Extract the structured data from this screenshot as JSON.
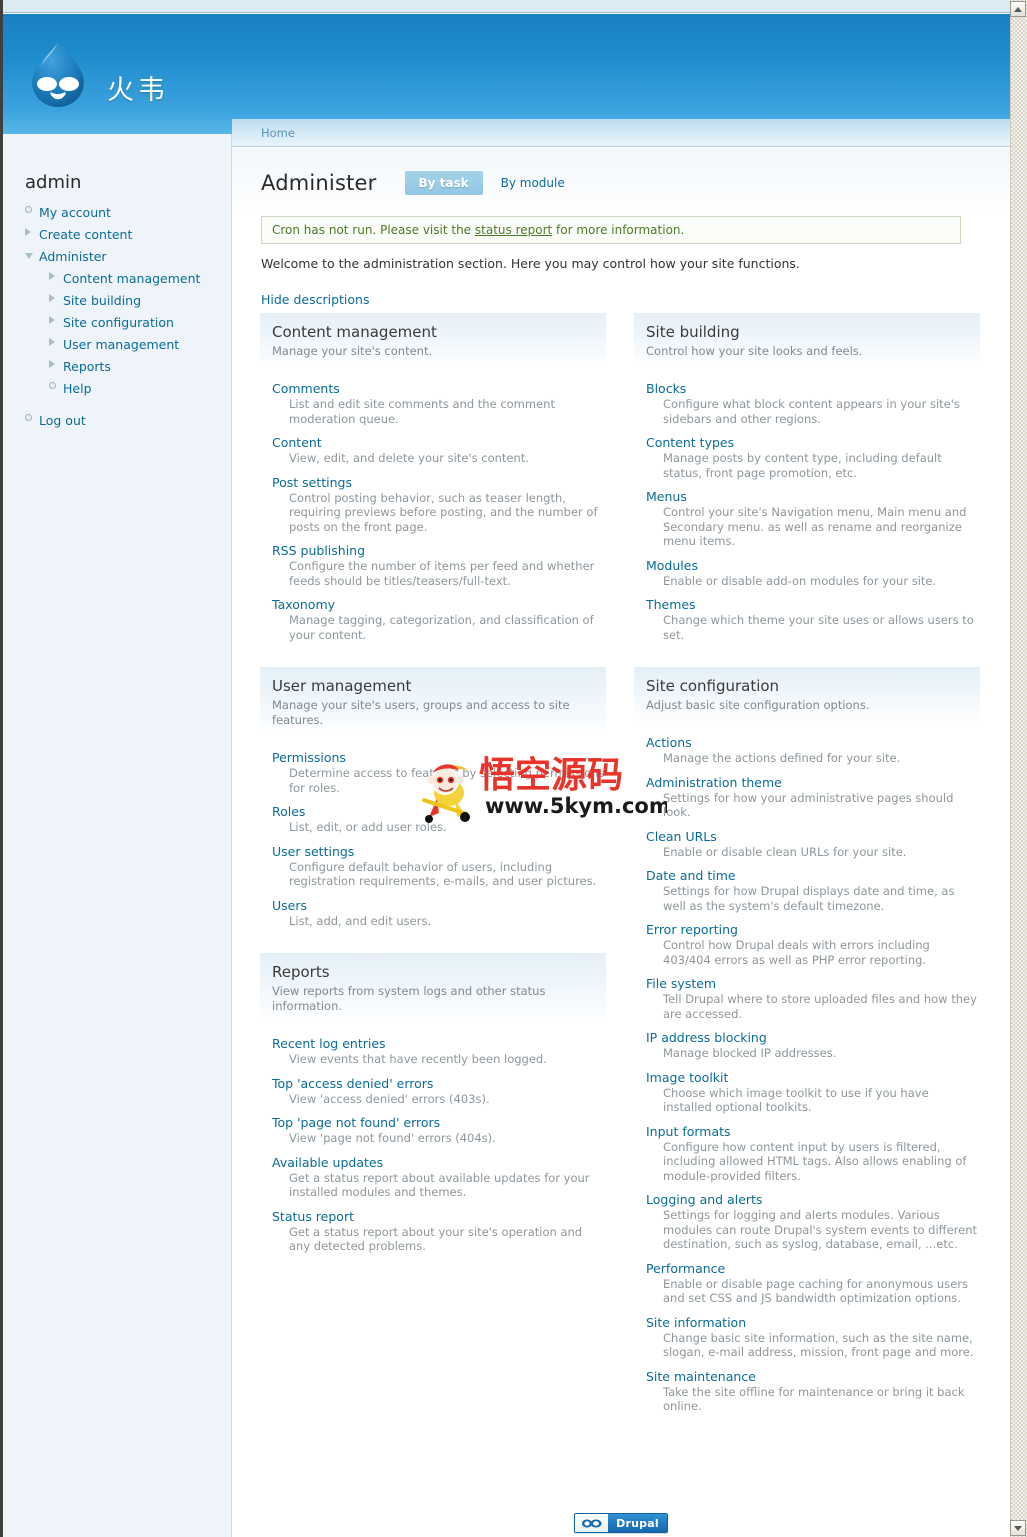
{
  "browser": {
    "scrollbar_up_icon": "scroll-up-arrow",
    "scrollbar_down_icon": "scroll-down-arrow"
  },
  "banner": {
    "logo_icon": "drupal-droplet-logo",
    "site_name": "火韦"
  },
  "sidebar": {
    "title": "admin",
    "items": [
      {
        "label": "My account",
        "level": 1,
        "marker": "circle"
      },
      {
        "label": "Create content",
        "level": 1,
        "marker": "triangle-right"
      },
      {
        "label": "Administer",
        "level": 1,
        "marker": "triangle-down"
      },
      {
        "label": "Content management",
        "level": 2,
        "marker": "triangle-right"
      },
      {
        "label": "Site building",
        "level": 2,
        "marker": "triangle-right"
      },
      {
        "label": "Site configuration",
        "level": 2,
        "marker": "triangle-right"
      },
      {
        "label": "User management",
        "level": 2,
        "marker": "triangle-right"
      },
      {
        "label": "Reports",
        "level": 2,
        "marker": "triangle-right"
      },
      {
        "label": "Help",
        "level": 2,
        "marker": "circle"
      },
      {
        "label": "Log out",
        "level": 1,
        "marker": "circle"
      }
    ]
  },
  "breadcrumb": {
    "home": "Home"
  },
  "header": {
    "title": "Administer",
    "tab_active": "By task",
    "tab_inactive": "By module"
  },
  "messages": {
    "cron_prefix": "Cron has not run. Please visit the ",
    "cron_link": "status report",
    "cron_suffix": " for more information."
  },
  "intro": {
    "welcome": "Welcome to the administration section. Here you may control how your site functions.",
    "hide_descriptions": "Hide descriptions"
  },
  "panels": {
    "content_management": {
      "title": "Content management",
      "subtitle": "Manage your site's content.",
      "items": [
        {
          "label": "Comments",
          "desc": "List and edit site comments and the comment moderation queue."
        },
        {
          "label": "Content",
          "desc": "View, edit, and delete your site's content."
        },
        {
          "label": "Post settings",
          "desc": "Control posting behavior, such as teaser length, requiring previews before posting, and the number of posts on the front page."
        },
        {
          "label": "RSS publishing",
          "desc": "Configure the number of items per feed and whether feeds should be titles/teasers/full-text."
        },
        {
          "label": "Taxonomy",
          "desc": "Manage tagging, categorization, and classification of your content."
        }
      ]
    },
    "site_building": {
      "title": "Site building",
      "subtitle": "Control how your site looks and feels.",
      "items": [
        {
          "label": "Blocks",
          "desc": "Configure what block content appears in your site's sidebars and other regions."
        },
        {
          "label": "Content types",
          "desc": "Manage posts by content type, including default status, front page promotion, etc."
        },
        {
          "label": "Menus",
          "desc": "Control your site's Navigation menu, Main menu and Secondary menu. as well as rename and reorganize menu items."
        },
        {
          "label": "Modules",
          "desc": "Enable or disable add-on modules for your site."
        },
        {
          "label": "Themes",
          "desc": "Change which theme your site uses or allows users to set."
        }
      ]
    },
    "user_management": {
      "title": "User management",
      "subtitle": "Manage your site's users, groups and access to site features.",
      "items": [
        {
          "label": "Permissions",
          "desc": "Determine access to features by selecting permissions for roles."
        },
        {
          "label": "Roles",
          "desc": "List, edit, or add user roles."
        },
        {
          "label": "User settings",
          "desc": "Configure default behavior of users, including registration requirements, e-mails, and user pictures."
        },
        {
          "label": "Users",
          "desc": "List, add, and edit users."
        }
      ]
    },
    "reports": {
      "title": "Reports",
      "subtitle": "View reports from system logs and other status information.",
      "items": [
        {
          "label": "Recent log entries",
          "desc": "View events that have recently been logged."
        },
        {
          "label": "Top 'access denied' errors",
          "desc": "View 'access denied' errors (403s)."
        },
        {
          "label": "Top 'page not found' errors",
          "desc": "View 'page not found' errors (404s)."
        },
        {
          "label": "Available updates",
          "desc": "Get a status report about available updates for your installed modules and themes."
        },
        {
          "label": "Status report",
          "desc": "Get a status report about your site's operation and any detected problems."
        }
      ]
    },
    "site_configuration": {
      "title": "Site configuration",
      "subtitle": "Adjust basic site configuration options.",
      "items": [
        {
          "label": "Actions",
          "desc": "Manage the actions defined for your site."
        },
        {
          "label": "Administration theme",
          "desc": "Settings for how your administrative pages should look."
        },
        {
          "label": "Clean URLs",
          "desc": "Enable or disable clean URLs for your site."
        },
        {
          "label": "Date and time",
          "desc": "Settings for how Drupal displays date and time, as well as the system's default timezone."
        },
        {
          "label": "Error reporting",
          "desc": "Control how Drupal deals with errors including 403/404 errors as well as PHP error reporting."
        },
        {
          "label": "File system",
          "desc": "Tell Drupal where to store uploaded files and how they are accessed."
        },
        {
          "label": "IP address blocking",
          "desc": "Manage blocked IP addresses."
        },
        {
          "label": "Image toolkit",
          "desc": "Choose which image toolkit to use if you have installed optional toolkits."
        },
        {
          "label": "Input formats",
          "desc": "Configure how content input by users is filtered, including allowed HTML tags. Also allows enabling of module-provided filters."
        },
        {
          "label": "Logging and alerts",
          "desc": "Settings for logging and alerts modules. Various modules can route Drupal's system events to different destination, such as syslog, database, email, ...etc."
        },
        {
          "label": "Performance",
          "desc": "Enable or disable page caching for anonymous users and set CSS and JS bandwidth optimization options."
        },
        {
          "label": "Site information",
          "desc": "Change basic site information, such as the site name, slogan, e-mail address, mission, front page and more."
        },
        {
          "label": "Site maintenance",
          "desc": "Take the site offline for maintenance or bring it back online."
        }
      ]
    }
  },
  "watermark": {
    "text_cn": "悟空源码",
    "url": "www.5kym.com",
    "icon": "monkey-king-mascot"
  },
  "footer": {
    "badge_label": "Drupal",
    "badge_icon": "drupal-droplet-small"
  },
  "colors": {
    "banner_blue": "#1880c4",
    "link_blue": "#0a6c96",
    "sidebar_bg": "#eef4fa",
    "tab_active_bg": "#92c8e4",
    "cron_text": "#4d7a2a",
    "watermark_red": "#e8342a"
  }
}
